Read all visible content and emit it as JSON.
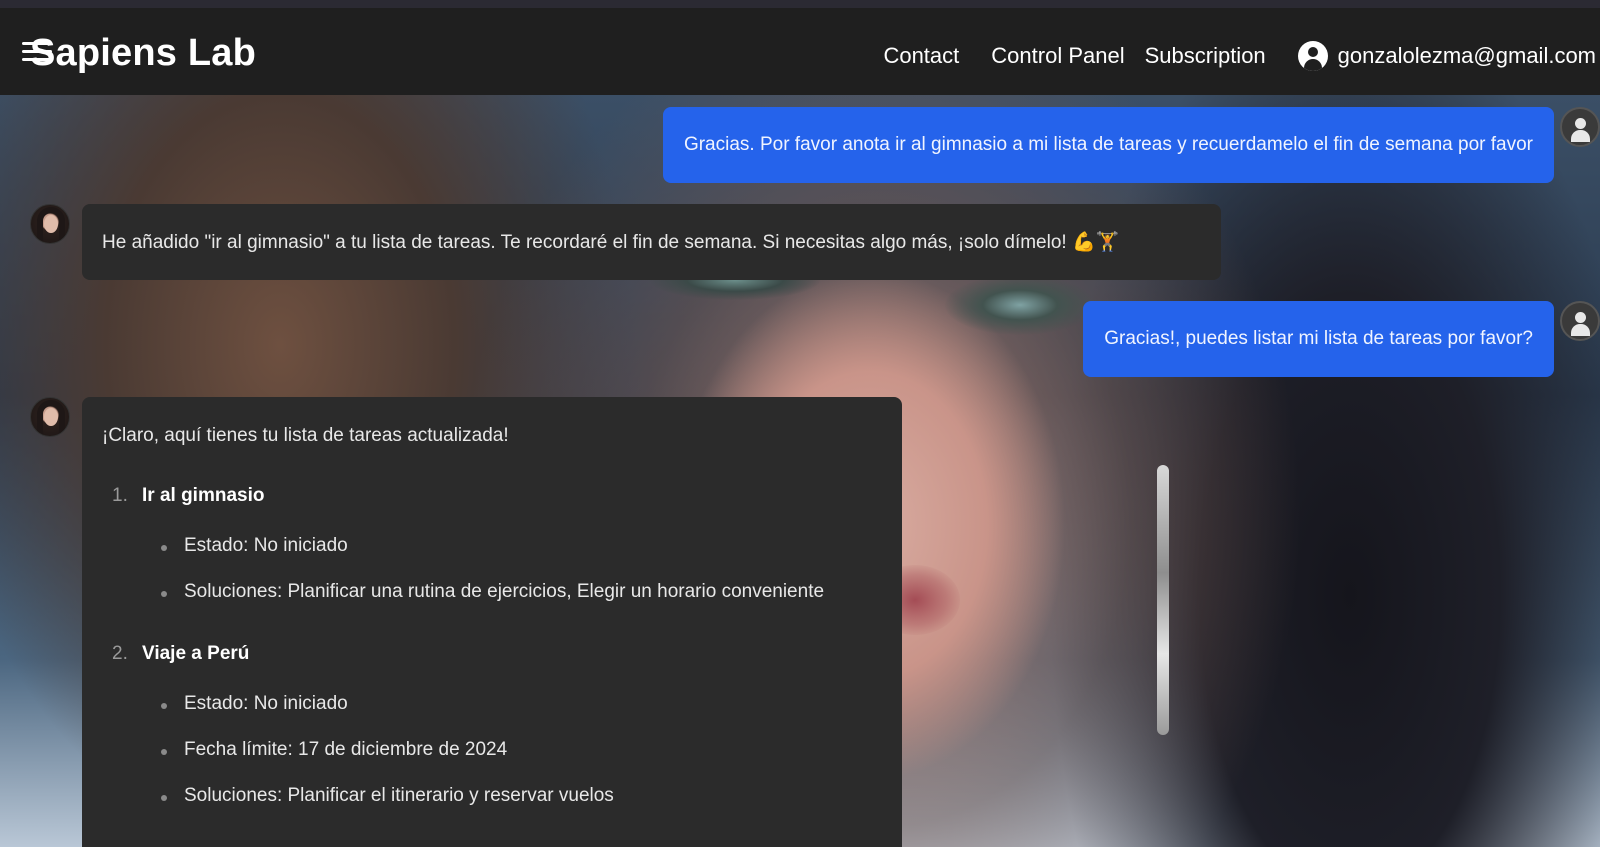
{
  "navbar": {
    "brand": "Sapiens Lab",
    "links": [
      "Contact",
      "Control Panel",
      "Subscription"
    ],
    "user_email": "gonzalolezma@gmail.com"
  },
  "chat": {
    "messages": [
      {
        "role": "user",
        "text": "Gracias. Por favor anota ir al gimnasio a mi lista de tareas y recuerdamelo el fin de semana por favor"
      },
      {
        "role": "assistant",
        "text": "He añadido \"ir al gimnasio\" a tu lista de tareas. Te recordaré el fin de semana. Si necesitas algo más, ¡solo dímelo! 💪🏋️"
      },
      {
        "role": "user",
        "text": "Gracias!, puedes listar mi lista de tareas por favor?"
      },
      {
        "role": "assistant",
        "intro": "¡Claro, aquí tienes tu lista de tareas actualizada!",
        "tasks": [
          {
            "number": "1.",
            "title": "Ir al gimnasio",
            "details": [
              "Estado: No iniciado",
              "Soluciones: Planificar una rutina de ejercicios, Elegir un horario conveniente"
            ]
          },
          {
            "number": "2.",
            "title": "Viaje a Perú",
            "details": [
              "Estado: No iniciado",
              "Fecha límite: 17 de diciembre de 2024",
              "Soluciones: Planificar el itinerario y reservar vuelos"
            ]
          }
        ]
      }
    ]
  }
}
